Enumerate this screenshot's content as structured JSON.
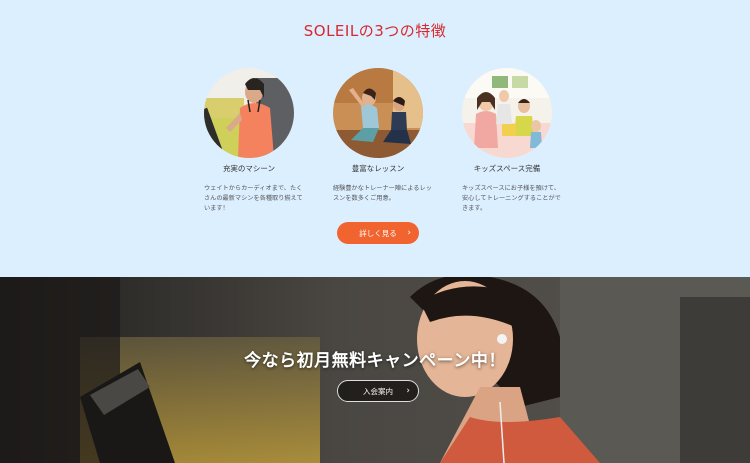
{
  "features_section": {
    "title": "SOLEILの3つの特徴",
    "items": [
      {
        "name": "充実のマシーン",
        "description": "ウェイトからカーディオまで、たくさんの最新マシンを各種取り揃えています！",
        "image": "woman-on-treadmill-photo"
      },
      {
        "name": "豊富なレッスン",
        "description": "経験豊かなトレーナー陣によるレッスンを数多くご用意。",
        "image": "group-yoga-lesson-photo"
      },
      {
        "name": "キッズスペース完備",
        "description": "キッズスペースにお子様を預けて、安心してトレーニングすることができます。",
        "image": "kids-space-photo"
      }
    ],
    "more_button": {
      "label": "詳しく見る",
      "icon": "chevron-right-icon"
    },
    "accent_color": "#d9272e",
    "button_color": "#f2642f",
    "background_color": "#dcefff"
  },
  "campaign_section": {
    "title": "今なら初月無料キャンペーン中！",
    "join_button": {
      "label": "入会案内",
      "icon": "chevron-right-icon"
    },
    "image": "woman-with-earphones-at-gym-photo"
  }
}
